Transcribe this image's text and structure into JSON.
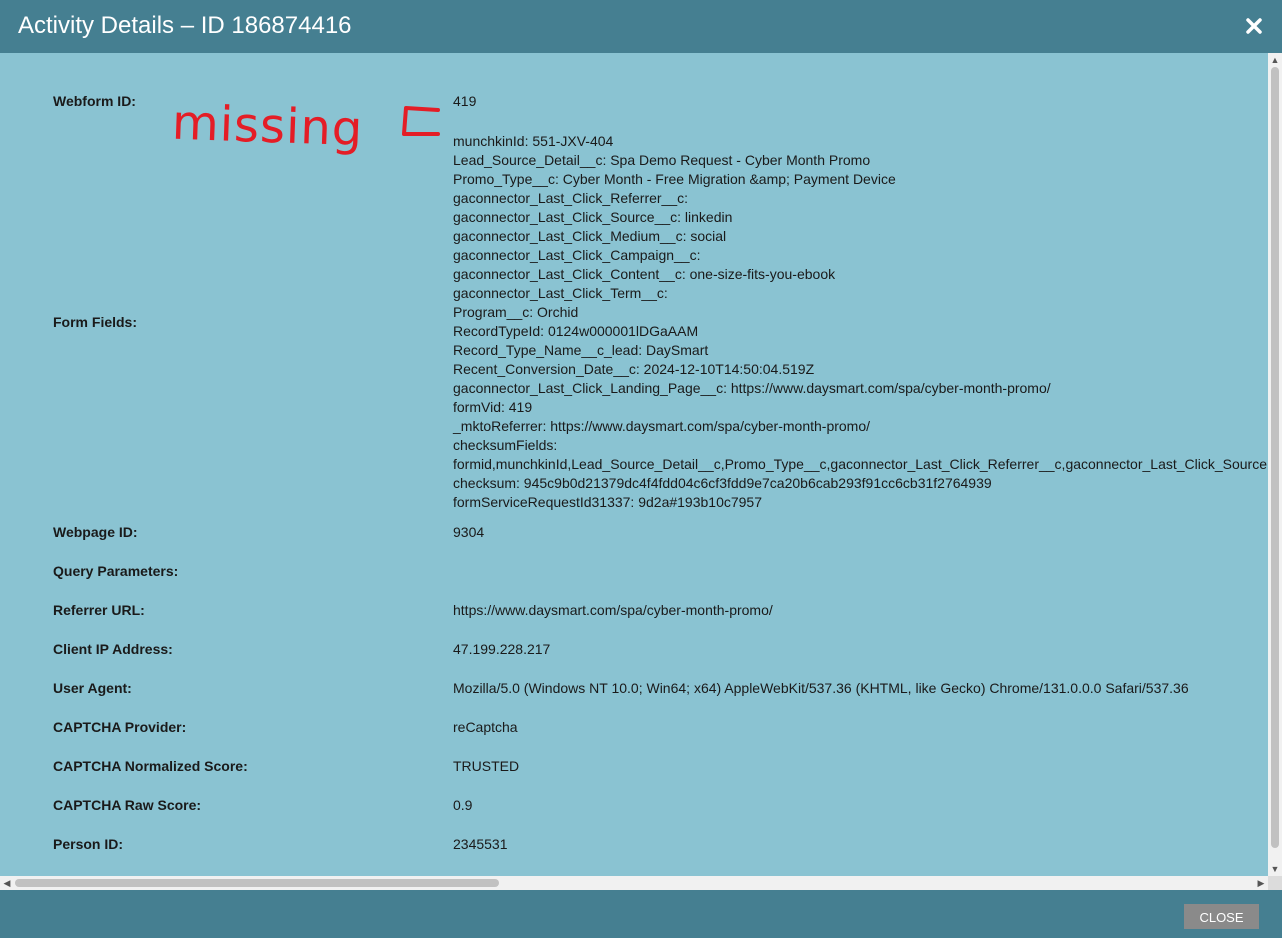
{
  "dialog": {
    "title": "Activity Details – ID 186874416",
    "close_icon": "close-icon",
    "close_button_label": "CLOSE"
  },
  "annotation": {
    "text": "missing",
    "bracket_text": "[",
    "color": "#e41d26"
  },
  "details": {
    "webform_id": {
      "label": "Webform ID:",
      "value": "419"
    },
    "form_fields": {
      "label": "Form Fields:",
      "lines": [
        "munchkinId: 551-JXV-404",
        "Lead_Source_Detail__c: Spa Demo Request - Cyber Month Promo",
        "Promo_Type__c: Cyber Month - Free Migration &amp; Payment Device",
        "gaconnector_Last_Click_Referrer__c:",
        "gaconnector_Last_Click_Source__c: linkedin",
        "gaconnector_Last_Click_Medium__c: social",
        "gaconnector_Last_Click_Campaign__c:",
        "gaconnector_Last_Click_Content__c: one-size-fits-you-ebook",
        "gaconnector_Last_Click_Term__c:",
        "Program__c: Orchid",
        "RecordTypeId: 0124w000001lDGaAAM",
        "Record_Type_Name__c_lead: DaySmart",
        "Recent_Conversion_Date__c: 2024-12-10T14:50:04.519Z",
        "gaconnector_Last_Click_Landing_Page__c: https://www.daysmart.com/spa/cyber-month-promo/",
        "formVid: 419",
        "_mktoReferrer: https://www.daysmart.com/spa/cyber-month-promo/",
        "checksumFields:",
        "formid,munchkinId,Lead_Source_Detail__c,Promo_Type__c,gaconnector_Last_Click_Referrer__c,gaconnector_Last_Click_Source",
        "checksum: 945c9b0d21379dc4f4fdd04c6cf3fdd9e7ca20b6cab293f91cc6cb31f2764939",
        "formServiceRequestId31337: 9d2a#193b10c7957"
      ]
    },
    "webpage_id": {
      "label": "Webpage ID:",
      "value": "9304"
    },
    "query_parameters": {
      "label": "Query Parameters:",
      "value": ""
    },
    "referrer_url": {
      "label": "Referrer URL:",
      "value": "https://www.daysmart.com/spa/cyber-month-promo/"
    },
    "client_ip": {
      "label": "Client IP Address:",
      "value": "47.199.228.217"
    },
    "user_agent": {
      "label": "User Agent:",
      "value": "Mozilla/5.0 (Windows NT 10.0; Win64; x64) AppleWebKit/537.36 (KHTML, like Gecko) Chrome/131.0.0.0 Safari/537.36"
    },
    "captcha_provider": {
      "label": "CAPTCHA Provider:",
      "value": "reCaptcha"
    },
    "captcha_normalized_score": {
      "label": "CAPTCHA Normalized Score:",
      "value": "TRUSTED"
    },
    "captcha_raw_score": {
      "label": "CAPTCHA Raw Score:",
      "value": "0.9"
    },
    "person_id": {
      "label": "Person ID:",
      "value": "2345531"
    }
  },
  "colors": {
    "header_bg": "#457f91",
    "content_bg": "#8ac3d2",
    "close_button_bg": "#8a8a8a"
  }
}
